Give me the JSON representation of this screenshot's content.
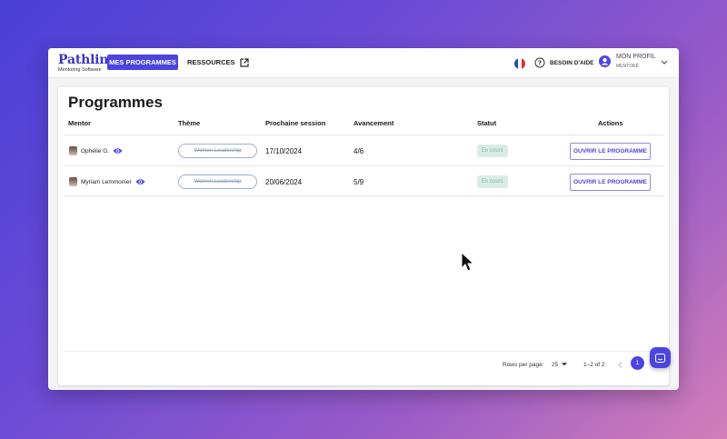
{
  "brand": {
    "name": "Pathline",
    "subtitle": "Mentoring Software",
    "accent": "#4c44e0"
  },
  "nav": {
    "programs_label": "MES PROGRAMMES",
    "resources_label": "RESSOURCES"
  },
  "header": {
    "help_label": "BESOIN D'AIDE",
    "profile_label": "MON PROFIL",
    "profile_role": "MENTORÉ",
    "language": "fr"
  },
  "main": {
    "title": "Programmes",
    "columns": [
      "Mentor",
      "Thème",
      "Prochaine session",
      "Avancement",
      "Statut",
      "Actions"
    ],
    "rows": [
      {
        "mentor": "Ophélie G.",
        "theme": "Women Leadership",
        "next_session": "17/10/2024",
        "progress": "4/6",
        "status": "En cours",
        "action": "OUVRIR LE PROGRAMME"
      },
      {
        "mentor": "Myriam Lemmonier",
        "theme": "Women Leadership",
        "next_session": "20/06/2024",
        "progress": "5/9",
        "status": "En cours",
        "action": "OUVRIR LE PROGRAMME"
      }
    ]
  },
  "pagination": {
    "rows_per_page_label": "Rows per page:",
    "rows_per_page": "25",
    "range": "1–2 of 2",
    "current_page": "1"
  }
}
